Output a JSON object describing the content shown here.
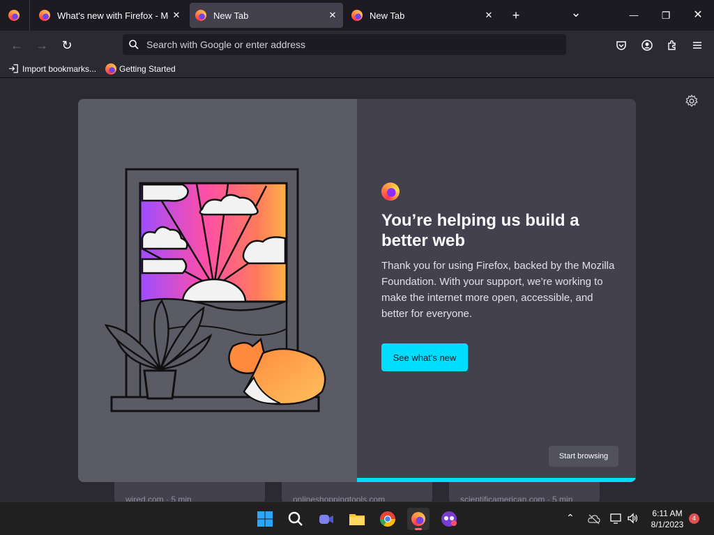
{
  "tabs": [
    {
      "title": "What's new with Firefox - More",
      "active": false
    },
    {
      "title": "New Tab",
      "active": true
    },
    {
      "title": "New Tab",
      "active": false
    }
  ],
  "tab_strip": {
    "new_tab": "+",
    "list_all": "⌄",
    "minimize": "—",
    "restore": "❐",
    "close": "✕"
  },
  "urlbar": {
    "placeholder": "Search with Google or enter address",
    "value": ""
  },
  "bookmarks": [
    {
      "label": "Import bookmarks...",
      "icon": "import-icon"
    },
    {
      "label": "Getting Started",
      "icon": "firefox-icon"
    }
  ],
  "modal": {
    "title": "You’re helping us build a better web",
    "body": "Thank you for using Firefox, backed by the Mozilla Foundation. With your support, we’re working to make the internet more open, accessible, and better for everyone.",
    "primary_button": "See what’s new",
    "secondary_button": "Start browsing",
    "progress": 1.0
  },
  "underlying_cards": [
    {
      "meta": "wired.com · 5 min"
    },
    {
      "meta": "onlineshoppingtools.com"
    },
    {
      "meta": "scientificamerican.com · 5 min"
    }
  ],
  "taskbar": {
    "apps": [
      "windows-start",
      "search",
      "teams-chat",
      "file-explorer",
      "chrome",
      "firefox",
      "other-app"
    ],
    "time": "6:11 AM",
    "date": "8/1/2023",
    "notifications": "4"
  },
  "colors": {
    "accent": "#00ddff",
    "modal_bg": "#42414d",
    "illustration_bg": "#5b5b66"
  }
}
